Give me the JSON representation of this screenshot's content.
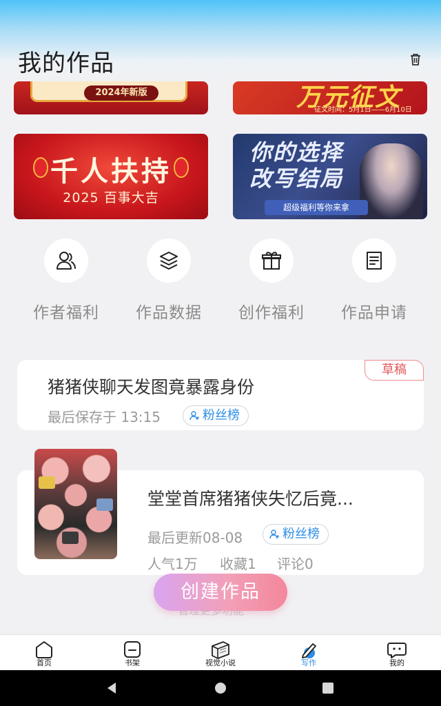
{
  "header": {
    "title": "我的作品",
    "delete_icon": "trash-icon"
  },
  "banners": [
    {
      "name": "yearbook",
      "text": "2024年新版"
    },
    {
      "name": "essay-contest",
      "text": "万元征文",
      "subtext": "征文时间：5月1日——6月10日"
    },
    {
      "name": "support-program",
      "text": "千人扶持",
      "subtext": "2025 百事大吉"
    },
    {
      "name": "rewrite-ending",
      "text": "你的选择改写结局",
      "subtext": "超级福利等你来拿"
    }
  ],
  "quick_actions": [
    {
      "label": "作者福利",
      "icon": "author-icon"
    },
    {
      "label": "作品数据",
      "icon": "layers-icon"
    },
    {
      "label": "创作福利",
      "icon": "gift-icon"
    },
    {
      "label": "作品申请",
      "icon": "document-icon"
    }
  ],
  "works": [
    {
      "title": "猪猪侠聊天发图竟暴露身份",
      "tag": "草稿",
      "status": "最后保存于 13:15",
      "badge": "粉丝榜"
    },
    {
      "title": "堂堂首席猪猪侠失忆后竟...",
      "status": "最后更新08-08",
      "badge": "粉丝榜",
      "popularity": "人气1万",
      "favorites": "收藏1",
      "comments": "评论0"
    }
  ],
  "fab": {
    "label": "创建作品",
    "ghost_text": "管理更多功能"
  },
  "tabbar": [
    {
      "label": "首页",
      "icon": "home-icon",
      "active": false
    },
    {
      "label": "书架",
      "icon": "bookshelf-icon",
      "active": false
    },
    {
      "label": "视觉小说",
      "icon": "visual-novel-icon",
      "active": false
    },
    {
      "label": "写作",
      "icon": "write-icon",
      "active": true
    },
    {
      "label": "我的",
      "icon": "profile-icon",
      "active": false
    }
  ],
  "colors": {
    "accent": "#2e8de6",
    "draft": "#e25a5a",
    "fab_start": "#d9a4f0",
    "fab_end": "#f3879c"
  }
}
